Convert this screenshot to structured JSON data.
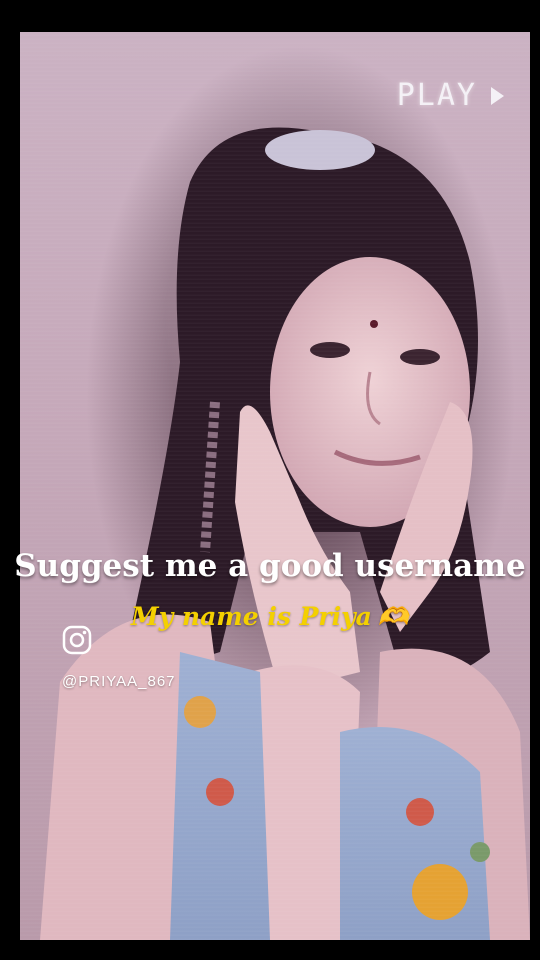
{
  "video": {
    "status_label": "PLAY",
    "status_icon": "play-triangle-icon"
  },
  "overlay": {
    "headline": "Suggest me a good username",
    "subline": "My name is Priya",
    "subline_emoji": "🫶",
    "social_icon": "instagram-icon",
    "handle": "@PRIYAA_867"
  },
  "colors": {
    "background": "#000000",
    "tint": "#c6a9ba",
    "headline_text": "#ffffff",
    "subline_text": "#f4d000",
    "overlay_text": "#f4f1f6"
  }
}
